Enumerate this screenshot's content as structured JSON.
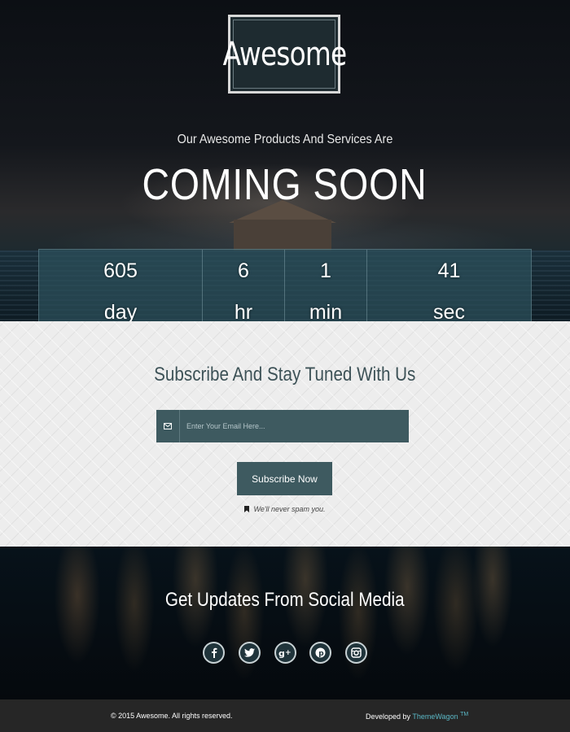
{
  "brand": {
    "logo_text": "Awesome"
  },
  "hero": {
    "tagline": "Our Awesome Products And Services Are",
    "headline": "COMING SOON"
  },
  "countdown": [
    {
      "value": "605",
      "unit": "day"
    },
    {
      "value": "6",
      "unit": "hr"
    },
    {
      "value": "1",
      "unit": "min"
    },
    {
      "value": "41",
      "unit": "sec"
    }
  ],
  "subscribe": {
    "title": "Subscribe And Stay Tuned With Us",
    "email_placeholder": "Enter Your Email Here...",
    "button_label": "Subscribe Now",
    "note": "We'll never spam you."
  },
  "social": {
    "title": "Get Updates From Social Media",
    "icons": [
      "facebook-icon",
      "twitter-icon",
      "google-plus-icon",
      "pinterest-icon",
      "instagram-icon"
    ]
  },
  "footer": {
    "copyright": "© 2015 Awesome. All rights reserved.",
    "developed_by": "Developed by",
    "developer_link": "ThemeWagon",
    "trademark": "TM"
  },
  "colors": {
    "accent_teal": "#3e5a60",
    "link": "#5bb8c6"
  }
}
